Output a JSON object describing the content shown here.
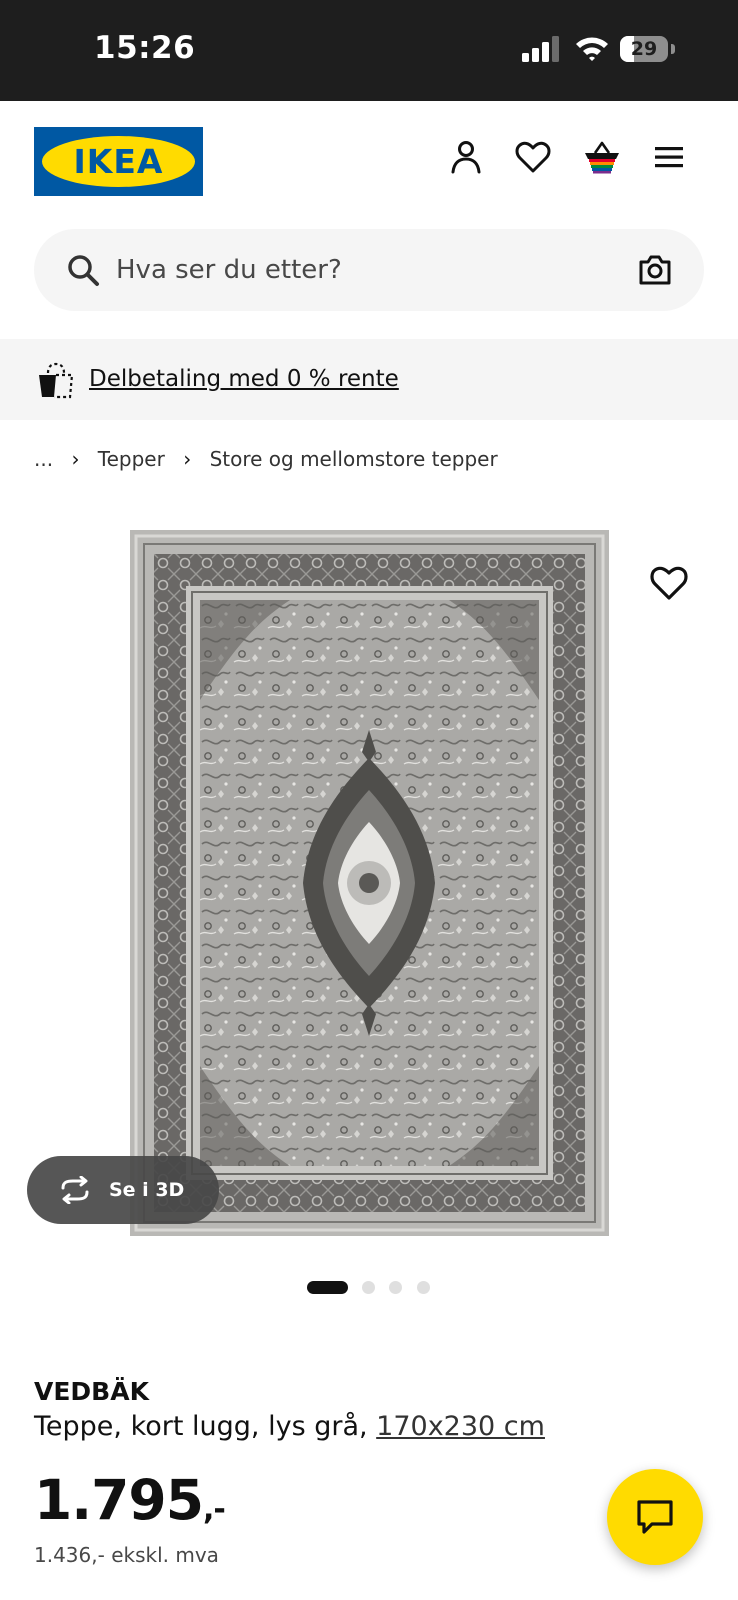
{
  "status_bar": {
    "time": "15:26",
    "battery": "29",
    "battery_level": 0.29,
    "signal_bars": 3
  },
  "header": {
    "logo_text": "IKEA",
    "icons": [
      "person-icon",
      "heart-icon",
      "basket-icon",
      "menu-icon"
    ]
  },
  "search": {
    "placeholder": "Hva ser du etter?"
  },
  "promo": {
    "text": "Delbetaling med 0 % rente"
  },
  "breadcrumb": {
    "ellipsis": "...",
    "items": [
      "Tepper",
      "Store og mellomstore tepper"
    ]
  },
  "gallery": {
    "view_3d_label": "Se i 3D",
    "image_count": 4,
    "active_index": 0
  },
  "product": {
    "name": "VEDBÄK",
    "description": "Teppe, kort lugg, lys grå, ",
    "size": "170x230 cm",
    "price": "1.795",
    "price_suffix": ",-",
    "price_excl_vat": "1.436,- ekskl. mva"
  },
  "colors": {
    "ikea_blue": "#0058a3",
    "ikea_yellow": "#ffdb00",
    "promo_bg": "#f5f5f5"
  }
}
